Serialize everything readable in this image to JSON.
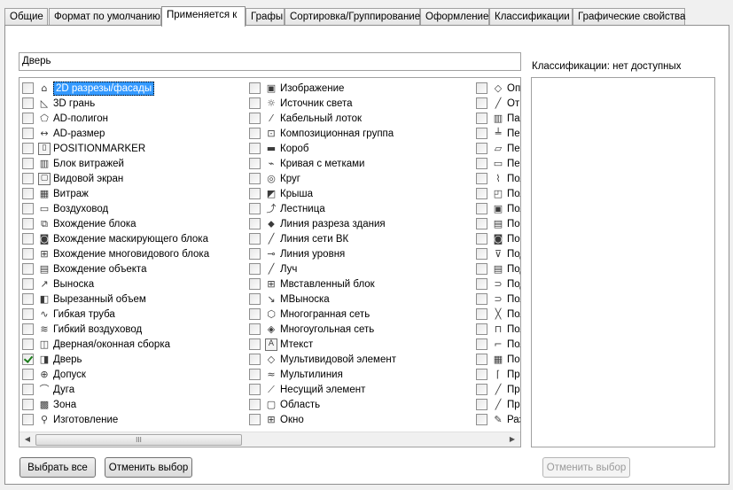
{
  "tabs": [
    {
      "label": "Общие"
    },
    {
      "label": "Формат по умолчанию"
    },
    {
      "label": "Применяется к"
    },
    {
      "label": "Графы"
    },
    {
      "label": "Сортировка/Группирование"
    },
    {
      "label": "Оформление"
    },
    {
      "label": "Классификации"
    },
    {
      "label": "Графические свойства"
    }
  ],
  "active_tab": "Применяется к",
  "filter": {
    "value": "Дверь"
  },
  "columns": [
    [
      {
        "label": "2D разрезы/фасады",
        "icon": "house-section-icon",
        "checked": false,
        "selected": true
      },
      {
        "label": "3D грань",
        "icon": "3d-face-icon",
        "checked": false
      },
      {
        "label": "AD-полигон",
        "icon": "polygon-icon",
        "checked": false
      },
      {
        "label": "AD-размер",
        "icon": "dimension-icon",
        "checked": false
      },
      {
        "label": "POSITIONMARKER",
        "icon": "position-marker-icon",
        "checked": false
      },
      {
        "label": "Блок витражей",
        "icon": "curtain-wall-block-icon",
        "checked": false
      },
      {
        "label": "Видовой экран",
        "icon": "viewport-icon",
        "checked": false
      },
      {
        "label": "Витраж",
        "icon": "curtain-wall-icon",
        "checked": false
      },
      {
        "label": "Воздуховод",
        "icon": "duct-icon",
        "checked": false
      },
      {
        "label": "Вхождение блока",
        "icon": "block-reference-icon",
        "checked": false
      },
      {
        "label": "Вхождение маскирующего блока",
        "icon": "mask-block-icon",
        "checked": false
      },
      {
        "label": "Вхождение многовидового блока",
        "icon": "multiview-block-icon",
        "checked": false
      },
      {
        "label": "Вхождение объекта",
        "icon": "object-reference-icon",
        "checked": false
      },
      {
        "label": "Выноска",
        "icon": "leader-icon",
        "checked": false
      },
      {
        "label": "Вырезанный объем",
        "icon": "cut-volume-icon",
        "checked": false
      },
      {
        "label": "Гибкая труба",
        "icon": "flex-pipe-icon",
        "checked": false
      },
      {
        "label": "Гибкий воздуховод",
        "icon": "flex-duct-icon",
        "checked": false
      },
      {
        "label": "Дверная/оконная сборка",
        "icon": "door-window-assembly-icon",
        "checked": false
      },
      {
        "label": "Дверь",
        "icon": "door-icon",
        "checked": true
      },
      {
        "label": "Допуск",
        "icon": "tolerance-icon",
        "checked": false
      },
      {
        "label": "Дуга",
        "icon": "arc-icon",
        "checked": false
      },
      {
        "label": "Зона",
        "icon": "zone-icon",
        "checked": false
      },
      {
        "label": "Изготовление",
        "icon": "fabrication-icon",
        "checked": false
      }
    ],
    [
      {
        "label": "Изображение",
        "icon": "image-icon",
        "checked": false
      },
      {
        "label": "Источник света",
        "icon": "light-source-icon",
        "checked": false
      },
      {
        "label": "Кабельный лоток",
        "icon": "cable-tray-icon",
        "checked": false
      },
      {
        "label": "Композиционная группа",
        "icon": "composition-group-icon",
        "checked": false
      },
      {
        "label": "Короб",
        "icon": "conduit-icon",
        "checked": false
      },
      {
        "label": "Кривая с метками",
        "icon": "tagged-curve-icon",
        "checked": false
      },
      {
        "label": "Круг",
        "icon": "circle-icon",
        "checked": false
      },
      {
        "label": "Крыша",
        "icon": "roof-icon",
        "checked": false
      },
      {
        "label": "Лестница",
        "icon": "stair-icon",
        "checked": false
      },
      {
        "label": "Линия разреза здания",
        "icon": "section-line-icon",
        "checked": false
      },
      {
        "label": "Линия сети ВК",
        "icon": "plumbing-line-icon",
        "checked": false
      },
      {
        "label": "Линия уровня",
        "icon": "level-line-icon",
        "checked": false
      },
      {
        "label": "Луч",
        "icon": "ray-icon",
        "checked": false
      },
      {
        "label": "Мвставленный блок",
        "icon": "minsert-block-icon",
        "checked": false
      },
      {
        "label": "МВыноска",
        "icon": "mleader-icon",
        "checked": false
      },
      {
        "label": "Многогранная сеть",
        "icon": "polyface-mesh-icon",
        "checked": false
      },
      {
        "label": "Многоугольная сеть",
        "icon": "polygon-mesh-icon",
        "checked": false
      },
      {
        "label": "Мтекст",
        "icon": "mtext-icon",
        "checked": false
      },
      {
        "label": "Мультивидовой элемент",
        "icon": "multiview-element-icon",
        "checked": false
      },
      {
        "label": "Мультилиния",
        "icon": "multiline-icon",
        "checked": false
      },
      {
        "label": "Несущий элемент",
        "icon": "structural-member-icon",
        "checked": false
      },
      {
        "label": "Область",
        "icon": "region-icon",
        "checked": false
      },
      {
        "label": "Окно",
        "icon": "window-icon",
        "checked": false
      }
    ],
    [
      {
        "label": "Опр",
        "icon": "tag-icon",
        "checked": false
      },
      {
        "label": "Отр",
        "icon": "line-segment-icon",
        "checked": false
      },
      {
        "label": "Пан",
        "icon": "panel-icon",
        "checked": false
      },
      {
        "label": "Пер",
        "icon": "railing-icon",
        "checked": false
      },
      {
        "label": "Пер",
        "icon": "slab-icon",
        "checked": false
      },
      {
        "label": "Пер",
        "icon": "floor-icon",
        "checked": false
      },
      {
        "label": "Пол",
        "icon": "polyline-icon",
        "checked": false
      },
      {
        "label": "Пол",
        "icon": "surface-icon",
        "checked": false
      },
      {
        "label": "Пол",
        "icon": "space-icon",
        "checked": false
      },
      {
        "label": "Пом",
        "icon": "room-icon",
        "checked": false
      },
      {
        "label": "Пом",
        "icon": "room-tag-icon",
        "checked": false
      },
      {
        "label": "Под",
        "icon": "support-icon",
        "checked": false
      },
      {
        "label": "Под",
        "icon": "pdf-underlay-icon",
        "checked": false
      },
      {
        "label": "Под",
        "icon": "connector-icon",
        "checked": false
      },
      {
        "label": "Пол",
        "icon": "pipe-connector-icon",
        "checked": false
      },
      {
        "label": "Пол",
        "icon": "pipe-fitting-icon",
        "checked": false
      },
      {
        "label": "Пол",
        "icon": "duct-fitting-icon",
        "checked": false
      },
      {
        "label": "Пол",
        "icon": "elbow-icon",
        "checked": false
      },
      {
        "label": "Пом",
        "icon": "grid-icon",
        "checked": false
      },
      {
        "label": "Про",
        "icon": "profile-icon",
        "checked": false
      },
      {
        "label": "Про",
        "icon": "pipe-icon",
        "checked": false
      },
      {
        "label": "Про",
        "icon": "line-icon",
        "checked": false
      },
      {
        "label": "Раз",
        "icon": "edit-icon",
        "checked": false
      }
    ]
  ],
  "classifications": {
    "label": "Классификации: нет доступных"
  },
  "buttons": {
    "select_all": "Выбрать все",
    "deselect": "Отменить выбор",
    "deselect_right": "Отменить выбор"
  },
  "scroll_grip": "III"
}
